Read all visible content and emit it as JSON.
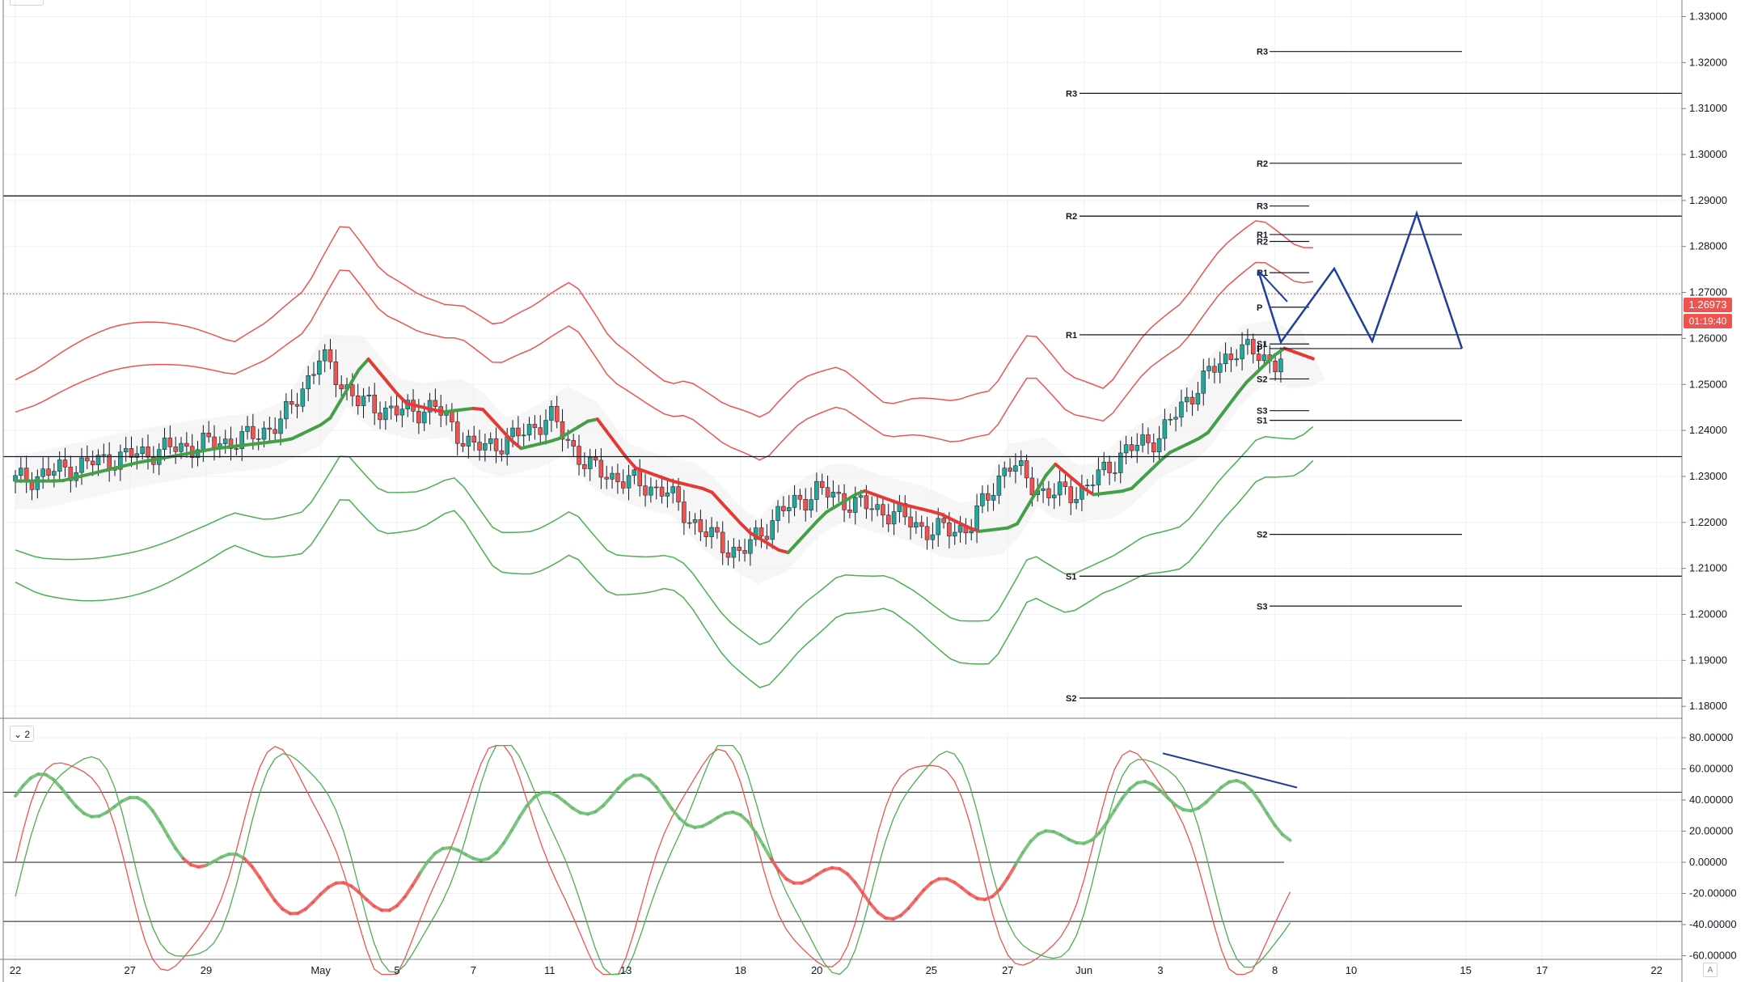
{
  "chart_data": {
    "type": "candlestick",
    "price_axis": {
      "min": 1.18,
      "max": 1.33,
      "ticks": [
        "1.33000",
        "1.32000",
        "1.31000",
        "1.30000",
        "1.29000",
        "1.28000",
        "1.27000",
        "1.26000",
        "1.25000",
        "1.24000",
        "1.23000",
        "1.22000",
        "1.21000",
        "1.20000",
        "1.19000",
        "1.18000"
      ],
      "tick_values": [
        1.33,
        1.32,
        1.31,
        1.3,
        1.29,
        1.28,
        1.27,
        1.26,
        1.25,
        1.24,
        1.23,
        1.22,
        1.21,
        1.2,
        1.19,
        1.18
      ]
    },
    "oscillator_axis": {
      "min": -80,
      "max": 80,
      "ticks": [
        "80.00000",
        "60.00000",
        "40.00000",
        "20.00000",
        "0.00000",
        "-20.00000",
        "-40.00000",
        "-60.00000",
        "-80.00000"
      ],
      "tick_values": [
        80,
        60,
        40,
        20,
        0,
        -20,
        -40,
        -60,
        -80
      ]
    },
    "time_axis": {
      "labels": [
        "22",
        "27",
        "29",
        "May",
        "5",
        "7",
        "11",
        "13",
        "18",
        "20",
        "25",
        "27",
        "Jun",
        "3",
        "8",
        "10",
        "15",
        "17",
        "22"
      ],
      "slots": [
        0,
        3,
        5,
        8,
        10,
        12,
        14,
        16,
        19,
        21,
        24,
        26,
        28,
        30,
        33,
        35,
        38,
        40,
        43
      ]
    },
    "last_price": "1.26973",
    "countdown": "01:19:40",
    "pivots_wide": [
      {
        "label": "R3",
        "value": 1.3133
      },
      {
        "label": "R2",
        "value": 1.2866
      },
      {
        "label": "R1",
        "value": 1.2608
      },
      {
        "label": "S1",
        "value": 1.2083
      },
      {
        "label": "S2",
        "value": 1.1818
      }
    ],
    "pivots_weekly": [
      {
        "label": "R3",
        "value": 1.3224
      },
      {
        "label": "R2",
        "value": 1.2981
      },
      {
        "label": "R1",
        "value": 1.2826
      },
      {
        "label": "P",
        "value": 1.2578
      },
      {
        "label": "S1",
        "value": 1.2422
      },
      {
        "label": "S2",
        "value": 1.2174
      },
      {
        "label": "S3",
        "value": 1.2018
      }
    ],
    "pivots_daily": [
      {
        "label": "R3",
        "value": 1.2888
      },
      {
        "label": "R2",
        "value": 1.2811
      },
      {
        "label": "R1",
        "value": 1.2743
      },
      {
        "label": "P",
        "value": 1.2668
      },
      {
        "label": "S1",
        "value": 1.2588
      },
      {
        "label": "S2",
        "value": 1.2512
      },
      {
        "label": "S3",
        "value": 1.2443
      }
    ],
    "horizontal_levels": [
      1.291,
      1.2343
    ],
    "oscillator_levels": [
      45,
      0,
      -38
    ],
    "pane_label": "2",
    "scale_mode": "A"
  }
}
